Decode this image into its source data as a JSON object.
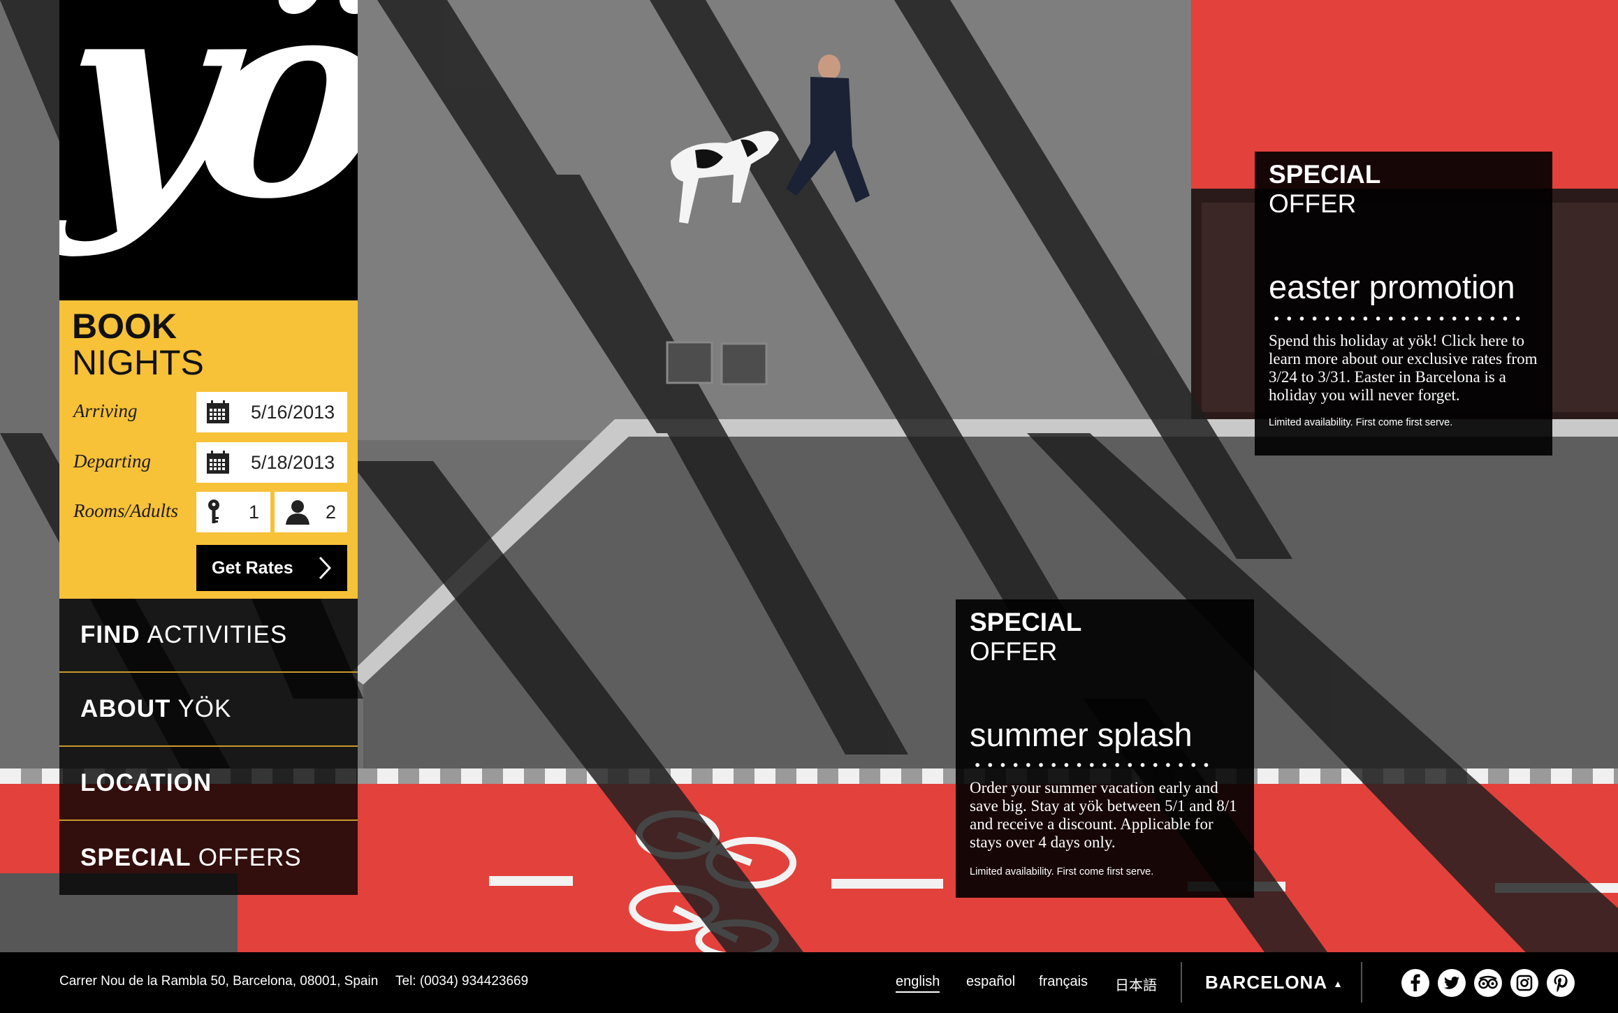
{
  "brand": {
    "logo_text": "yök"
  },
  "booking": {
    "title_bold": "BOOK",
    "title_light": "NIGHTS",
    "arriving_label": "Arriving",
    "arriving_value": "5/16/2013",
    "departing_label": "Departing",
    "departing_value": "5/18/2013",
    "rooms_adults_label": "Rooms/Adults",
    "rooms_value": "1",
    "adults_value": "2",
    "submit_label": "Get Rates"
  },
  "nav": {
    "items": [
      {
        "bold": "FIND",
        "light": "ACTIVITIES"
      },
      {
        "bold": "ABOUT",
        "light": "YÖK"
      },
      {
        "bold": "LOCATION",
        "light": ""
      },
      {
        "bold": "SPECIAL",
        "light": "OFFERS"
      }
    ]
  },
  "offers": [
    {
      "tag_bold": "SPECIAL",
      "tag_light": "OFFER",
      "title": "easter promotion",
      "description": "Spend this holiday at yök! Click here to learn more about our exclusive rates from 3/24 to 3/31. Easter in Barcelona is a holiday you will never forget.",
      "note": "Limited availability. First come first serve."
    },
    {
      "tag_bold": "SPECIAL",
      "tag_light": "OFFER",
      "title": "summer splash",
      "description": "Order your summer vacation early and save big. Stay at yök between 5/1 and 8/1 and receive a discount. Applicable for stays over 4 days only.",
      "note": "Limited availability. First come first serve."
    }
  ],
  "footer": {
    "address": "Carrer Nou de la Rambla 50, Barcelona, 08001, Spain",
    "phone": "Tel: (0034) 934423669",
    "languages": [
      "english",
      "español",
      "français",
      "日本語"
    ],
    "active_language": "english",
    "city": "BARCELONA",
    "social_icons": [
      "facebook-icon",
      "twitter-icon",
      "tripadvisor-icon",
      "instagram-icon",
      "pinterest-icon"
    ]
  },
  "colors": {
    "accent_yellow": "#f7c138",
    "lane_red": "#e3413c",
    "panel_black": "#000000"
  }
}
